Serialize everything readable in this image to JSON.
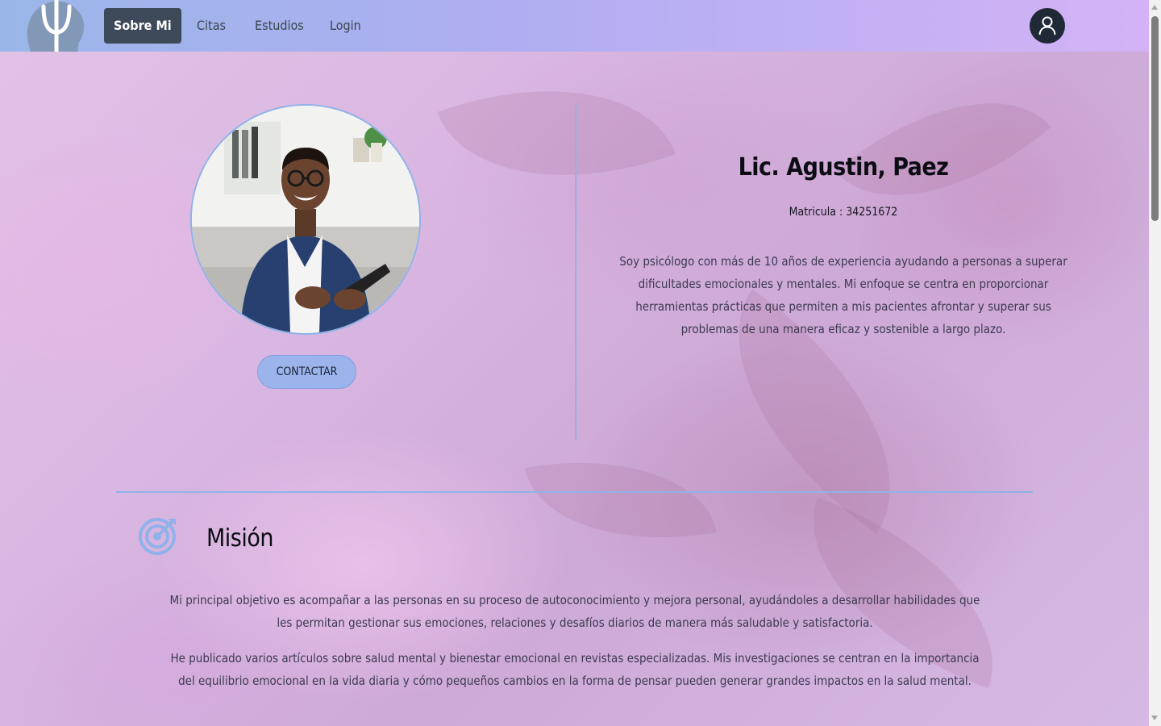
{
  "nav": {
    "items": [
      {
        "label": "Sobre Mi",
        "active": true
      },
      {
        "label": "Citas",
        "active": false
      },
      {
        "label": "Estudios",
        "active": false
      },
      {
        "label": "Login",
        "active": false
      }
    ]
  },
  "profile": {
    "name": "Lic. Agustin, Paez",
    "matricula": "Matricula : 34251672",
    "bio": "Soy psicólogo con más de 10 años de experiencia ayudando a personas a superar dificultades emocionales y mentales. Mi enfoque se centra en proporcionar herramientas prácticas que permiten a mis pacientes afrontar y superar sus problemas de una manera eficaz y sostenible a largo plazo.",
    "contact_label": "CONTACTAR"
  },
  "mission": {
    "title": "Misión",
    "paragraphs": [
      "Mi principal objetivo es acompañar a las personas en su proceso de autoconocimiento y mejora personal, ayudándoles a desarrollar habilidades que les permitan gestionar sus emociones, relaciones y desafíos diarios de manera más saludable y satisfactoria.",
      "He publicado varios artículos sobre salud mental y bienestar emocional en revistas especializadas. Mis investigaciones se centran en la importancia del equilibrio emocional en la vida diaria y cómo pequeños cambios en la forma de pensar pueden generar grandes impactos en la salud mental."
    ]
  },
  "colors": {
    "accent": "#8fb2ea",
    "nav_active": "#3e4a5a",
    "button": "#9bb4ec"
  },
  "icons": {
    "logo": "psi-head-logo",
    "user": "user-icon",
    "mission": "target-icon"
  }
}
